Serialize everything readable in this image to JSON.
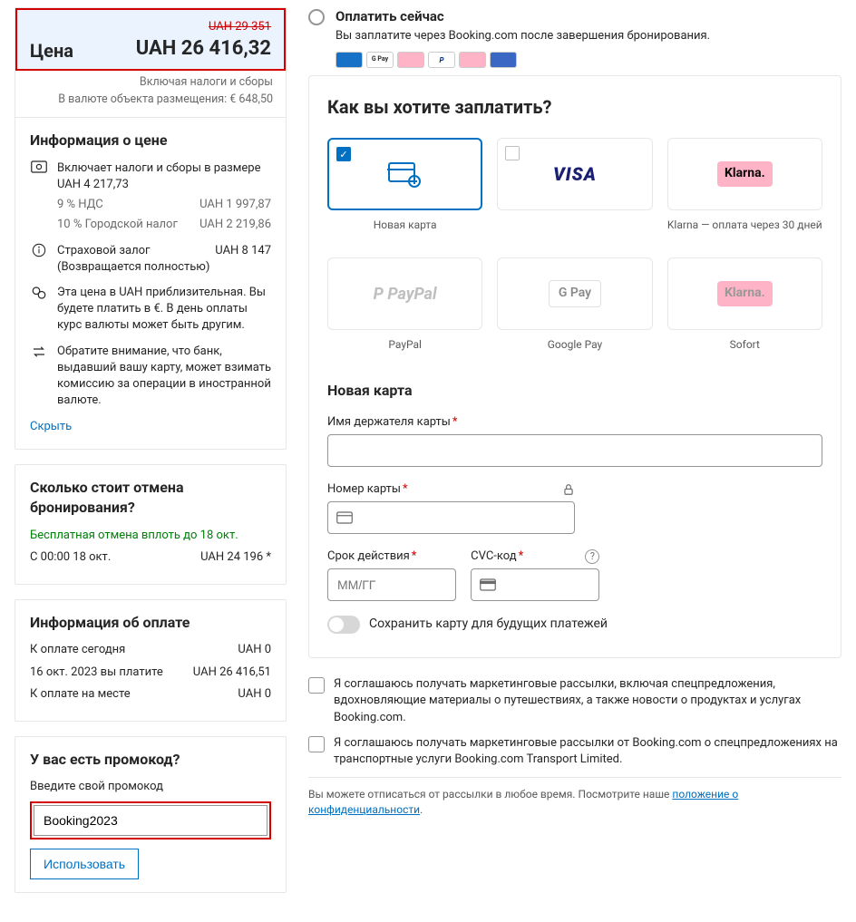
{
  "price": {
    "label": "Цена",
    "original": "UAH 29 351",
    "current": "UAH 26 416,32",
    "taxes_note": "Включая налоги и сборы",
    "property_currency": "В валюте объекта размещения: € 648,50"
  },
  "price_info": {
    "title": "Информация о цене",
    "taxes_line": "Включает налоги и сборы в размере UAH 4 217,73",
    "breakdown": [
      {
        "label": "9 % НДС",
        "value": "UAH 1 997,87"
      },
      {
        "label": "10 % Городской налог",
        "value": "UAH 2 219,86"
      }
    ],
    "deposit_label": "Страховой залог",
    "deposit_value": "UAH 8 147",
    "deposit_note": "(Возвращается полностью)",
    "approx_note": "Эта цена в UAH приблизительная. Вы будете платить в €. В день оплаты курс валюты может быть другим.",
    "bank_note": "Обратите внимание, что банк, выдавший вашу карту, может взимать комиссию за операции в иностранной валюте.",
    "hide": "Скрыть"
  },
  "cancel": {
    "title": "Сколько стоит отмена бронирования?",
    "free_line": "Бесплатная отмена вплоть до 18 окт.",
    "row_label": "С 00:00 18 окт.",
    "row_value": "UAH 24 196 *"
  },
  "payment_info": {
    "title": "Информация об оплате",
    "rows": [
      {
        "label": "К оплате сегодня",
        "value": "UAH 0"
      },
      {
        "label": "16 окт. 2023 вы платите",
        "value": "UAH 26 416,51"
      },
      {
        "label": "К оплате на месте",
        "value": "UAH 0"
      }
    ]
  },
  "promo": {
    "title": "У вас есть промокод?",
    "label": "Введите свой промокод",
    "value": "Booking2023",
    "button": "Использовать"
  },
  "pay_now": {
    "title": "Оплатить сейчас",
    "desc": "Вы заплатите через Booking.com после завершения бронирования."
  },
  "methods": {
    "heading": "Как вы хотите заплатить?",
    "row1": [
      {
        "id": "new-card",
        "label": "Новая карта",
        "selected": true,
        "brand": "newcard"
      },
      {
        "id": "visa",
        "label": "",
        "selected": false,
        "brand": "visa"
      },
      {
        "id": "klarna30",
        "label": "Klarna — оплата через 30 дней",
        "selected": false,
        "brand": "klarna"
      }
    ],
    "row2": [
      {
        "id": "paypal",
        "label": "PayPal",
        "brand": "paypal"
      },
      {
        "id": "gpay",
        "label": "Google Pay",
        "brand": "gpay"
      },
      {
        "id": "sofort",
        "label": "Sofort",
        "brand": "klarna-grey"
      }
    ]
  },
  "card_form": {
    "title": "Новая карта",
    "holder_label": "Имя держателя карты",
    "number_label": "Номер карты",
    "expiry_label": "Срок действия",
    "expiry_ph": "ММ/ГГ",
    "cvc_label": "CVC-код",
    "save_toggle": "Сохранить карту для будущих платежей"
  },
  "consent": {
    "c1": "Я соглашаюсь получать маркетинговые рассылки, включая спецпредложения, вдохновляющие материалы о путешествиях, а также новости о продуктах и услугах Booking.com.",
    "c2": "Я соглашаюсь получать маркетинговые рассылки от Booking.com о спецпредложениях на транспортные услуги Booking.com Transport Limited.",
    "unsub": "Вы можете отписаться от рассылки в любое время. Посмотрите наше ",
    "privacy_link": "положение о конфиденциальности"
  }
}
